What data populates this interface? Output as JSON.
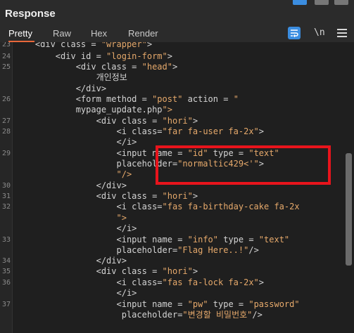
{
  "header": {
    "title": "Response"
  },
  "tabs": [
    {
      "label": "Pretty",
      "active": true
    },
    {
      "label": "Raw",
      "active": false
    },
    {
      "label": "Hex",
      "active": false
    },
    {
      "label": "Render",
      "active": false
    }
  ],
  "toolbar": {
    "wrap_icon": "wrap-lines-icon",
    "newline_label": "\\n",
    "menu_icon": "menu-icon"
  },
  "colors": {
    "accent": "#e8673a",
    "wrap_button": "#3b8de0",
    "highlight_box": "#e8141c",
    "string": "#e6a96b"
  },
  "line_numbers": [
    "23",
    "24",
    "25",
    "",
    "",
    "26",
    "",
    "27",
    "28",
    "",
    "29",
    "",
    "",
    "30",
    "31",
    "32",
    "",
    "",
    "33",
    "",
    "34",
    "35",
    "36",
    "",
    "37",
    ""
  ],
  "code_lines": [
    "    <div class = \"wrapper\">",
    "        <div id = \"login-form\">",
    "            <div class = \"head\">",
    "                개인정보",
    "            </div>",
    "            <form method = \"post\" action = \"",
    "            mypage_update.php\">",
    "                <div class = \"hori\">",
    "                    <i class=\"far fa-user fa-2x\">",
    "                    </i>",
    "                    <input name = \"id\" type = \"text\"",
    "                    placeholder=\"normaltic429<'\">",
    "                    \"/>",
    "                </div>",
    "                <div class = \"hori\">",
    "                    <i class=\"fas fa-birthday-cake fa-2x",
    "                    \">",
    "                    </i>",
    "                    <input name = \"info\" type = \"text\"",
    "                    placeholder=\"Flag Here..!\"/>",
    "                </div>",
    "                <div class = \"hori\">",
    "                    <i class=\"fas fa-lock fa-2x\">",
    "                    </i>",
    "                    <input name = \"pw\" type = \"password\"",
    "                     placeholder=\"변경할 비밀번호\"/>"
  ]
}
